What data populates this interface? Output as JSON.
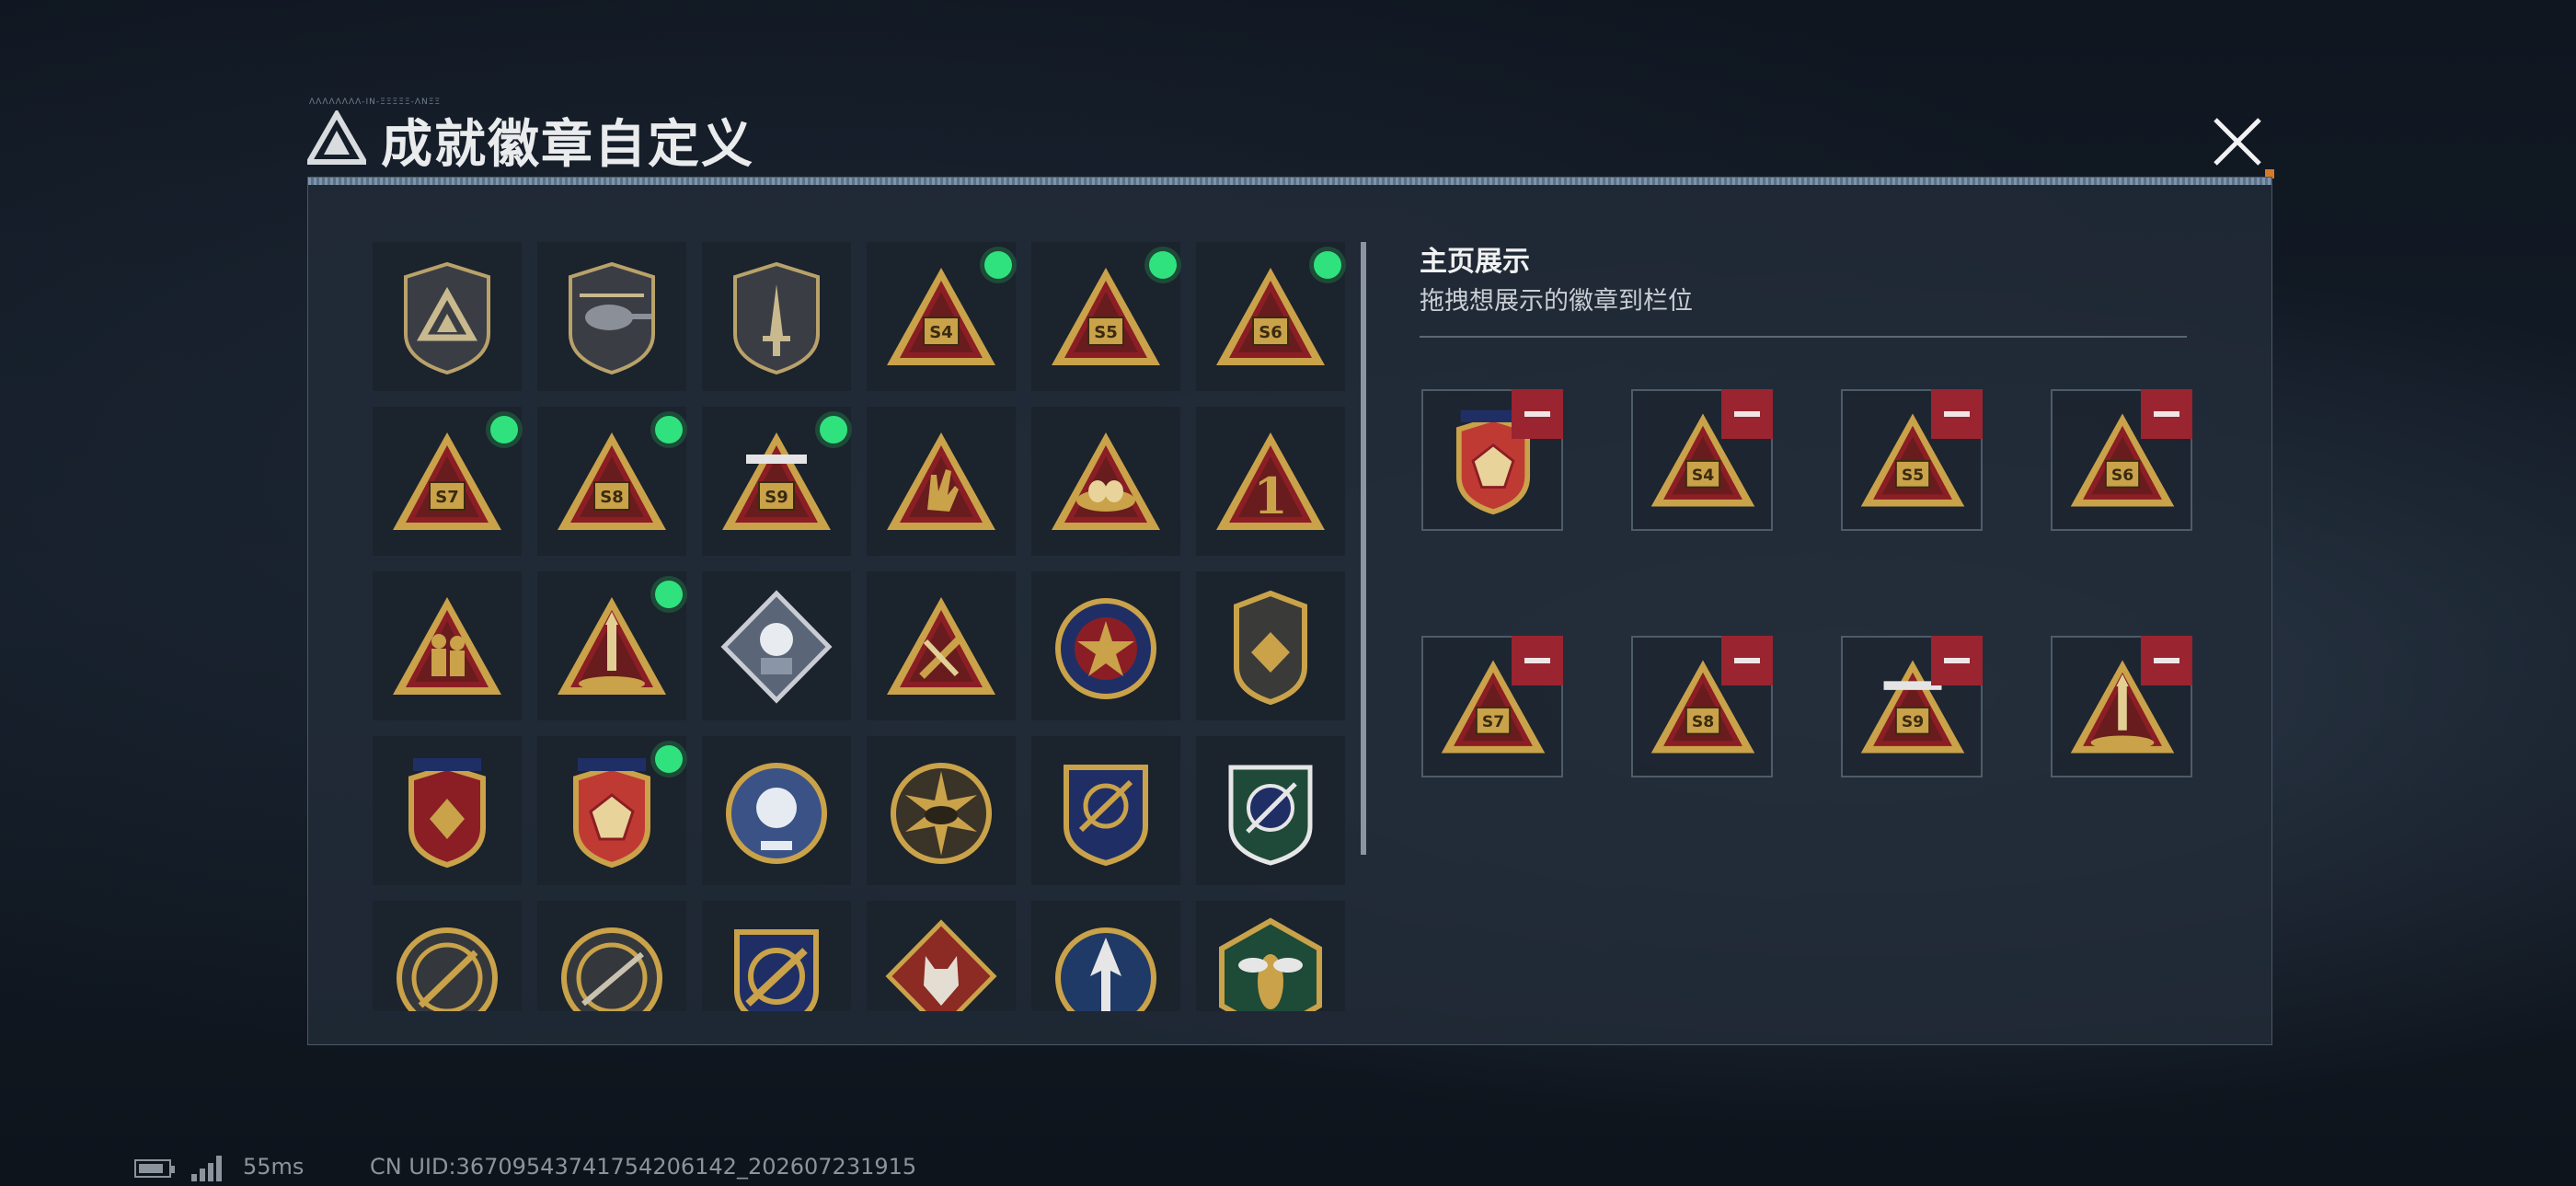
{
  "title": "成就徽章自定义",
  "title_tiny": "ΛΛΛΛΛΛΛΛ-ΙΝ-ΞΞΞΞΞ-ΛΝΞΞ",
  "close_icon": "close-icon",
  "showcase": {
    "title": "主页展示",
    "subtitle": "拖拽想展示的徽章到栏位",
    "remove_icon": "minus-icon",
    "slots": [
      {
        "badge": "badge-heart-gem-shield"
      },
      {
        "badge": "badge-s4"
      },
      {
        "badge": "badge-s5"
      },
      {
        "badge": "badge-s6"
      },
      {
        "badge": "badge-s7"
      },
      {
        "badge": "badge-s8"
      },
      {
        "badge": "badge-s9"
      },
      {
        "badge": "badge-rocket"
      }
    ]
  },
  "badges": [
    {
      "icon": "badge-delta-logo",
      "equipped": false
    },
    {
      "icon": "badge-helicopter",
      "equipped": false
    },
    {
      "icon": "badge-dagger",
      "equipped": false
    },
    {
      "icon": "badge-s4",
      "label": "S4",
      "equipped": true
    },
    {
      "icon": "badge-s5",
      "label": "S5",
      "equipped": true
    },
    {
      "icon": "badge-s6",
      "label": "S6",
      "equipped": true
    },
    {
      "icon": "badge-s7",
      "label": "S7",
      "equipped": true
    },
    {
      "icon": "badge-s8",
      "label": "S8",
      "equipped": true
    },
    {
      "icon": "badge-s9",
      "label": "S9",
      "equipped": true
    },
    {
      "icon": "badge-rock-hand",
      "equipped": false
    },
    {
      "icon": "badge-eggs-nest",
      "equipped": false
    },
    {
      "icon": "badge-number-one",
      "label": "1",
      "equipped": false
    },
    {
      "icon": "badge-soldiers",
      "equipped": false
    },
    {
      "icon": "badge-rocket",
      "equipped": true
    },
    {
      "icon": "badge-rose-diamond",
      "equipped": false
    },
    {
      "icon": "badge-tools-triangle",
      "equipped": false
    },
    {
      "icon": "badge-star-compass",
      "equipped": false
    },
    {
      "icon": "badge-wings-shield",
      "equipped": false
    },
    {
      "icon": "badge-diamond-shield",
      "equipped": false
    },
    {
      "icon": "badge-heart-gem-shield",
      "equipped": true
    },
    {
      "icon": "badge-skull-round",
      "equipped": false
    },
    {
      "icon": "badge-sunburst-tank",
      "equipped": false
    },
    {
      "icon": "badge-crosshair-shield",
      "equipped": false
    },
    {
      "icon": "badge-green-crosshair",
      "equipped": false
    },
    {
      "icon": "badge-rifle-round",
      "equipped": false
    },
    {
      "icon": "badge-sniper-round",
      "equipped": false
    },
    {
      "icon": "badge-gold-crosshair",
      "equipped": false
    },
    {
      "icon": "badge-wolf-diamond",
      "equipped": false
    },
    {
      "icon": "badge-arrow-circle",
      "equipped": false
    },
    {
      "icon": "badge-wasp-hexagon",
      "equipped": false
    }
  ],
  "colors": {
    "gold": "#c9a24a",
    "red": "#8b1e24",
    "equipped_dot": "#2fe27e",
    "remove": "#9a2430"
  },
  "footer": {
    "ping": "55ms",
    "uid": "CN UID:3670954374175420614​2_202607231915"
  }
}
